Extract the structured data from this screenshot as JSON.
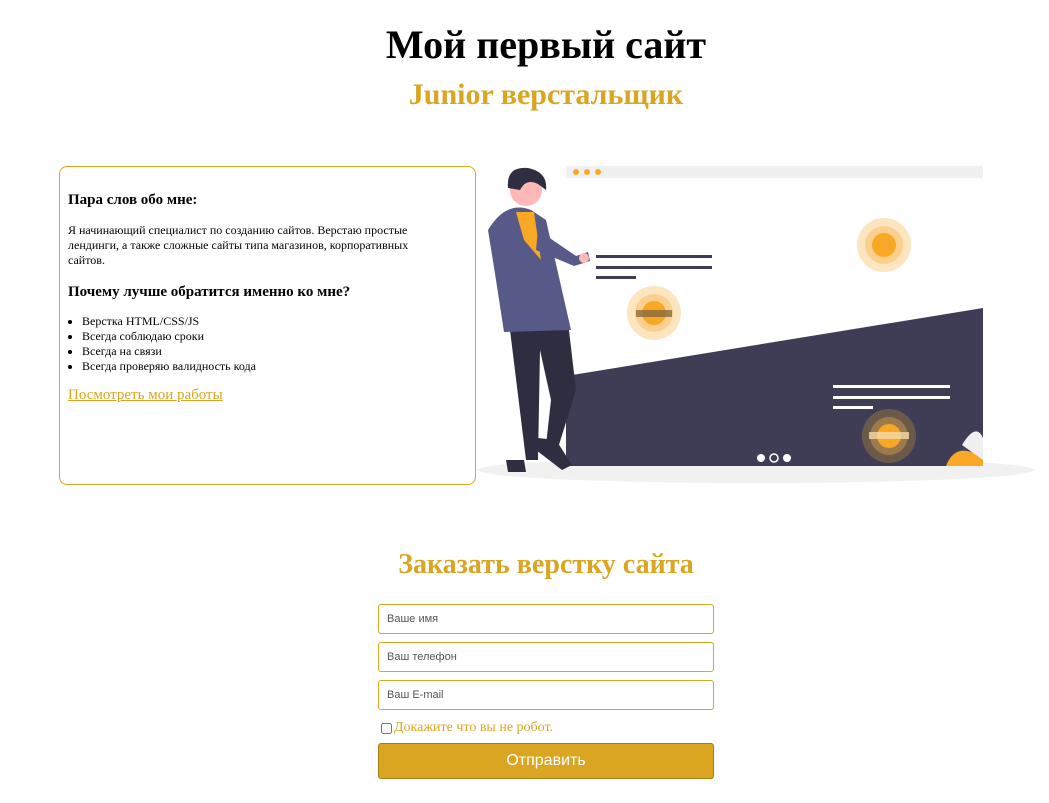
{
  "header": {
    "title": "Мой первый сайт",
    "subtitle": "Junior верстальщик"
  },
  "about": {
    "heading": "Пара слов обо мне:",
    "text": "Я начинающий специалист по созданию сайтов. Верстаю простые лендинги, а также сложные сайты типа магазинов, корпоративных сайтов.",
    "why_heading": "Почему лучше обратится именно ко мне?",
    "advantages": [
      "Верстка HTML/CSS/JS",
      "Всегда соблюдаю сроки",
      "Всегда на связи",
      "Всегда проверяю валидность кода"
    ],
    "link_label": "Посмотреть мои работы"
  },
  "order": {
    "title": "Заказать верстку сайта",
    "name_placeholder": "Ваше имя",
    "phone_placeholder": "Ваш телефон",
    "email_placeholder": "Ваш E-mail",
    "robot_label": "Докажите что вы не робот.",
    "submit_label": "Отправить"
  },
  "colors": {
    "accent": "#DAA520",
    "dark": "#3F3D56",
    "orange": "#F9A826"
  }
}
